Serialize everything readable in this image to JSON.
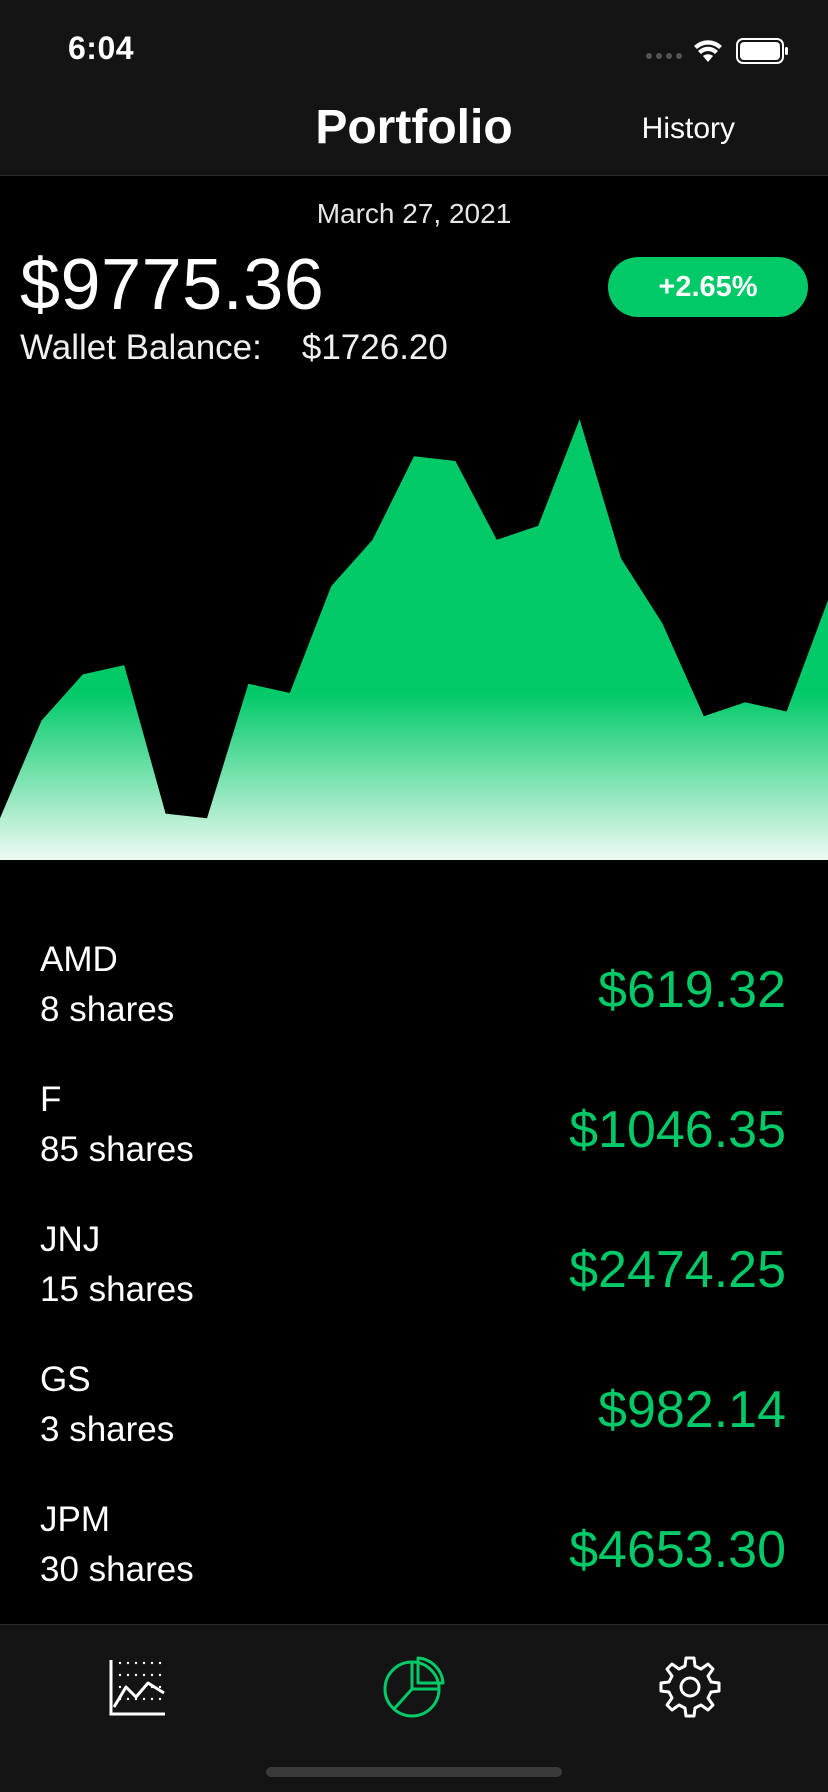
{
  "status_bar": {
    "time": "6:04",
    "icons": [
      "signal-icon",
      "wifi-icon",
      "battery-icon"
    ]
  },
  "nav": {
    "title": "Portfolio",
    "history_label": "History"
  },
  "summary": {
    "date": "March 27, 2021",
    "total_value": "$9775.36",
    "change": "+2.65%",
    "wallet_label": "Wallet Balance:",
    "wallet_value": "$1726.20"
  },
  "chart_data": {
    "type": "area",
    "values": [
      0.09,
      0.3,
      0.4,
      0.42,
      0.1,
      0.09,
      0.38,
      0.36,
      0.59,
      0.69,
      0.87,
      0.86,
      0.69,
      0.72,
      0.95,
      0.65,
      0.51,
      0.31,
      0.34,
      0.32,
      0.56
    ],
    "color": "#00c968"
  },
  "holdings": [
    {
      "symbol": "AMD",
      "shares": "8 shares",
      "value": "$619.32"
    },
    {
      "symbol": "F",
      "shares": "85 shares",
      "value": "$1046.35"
    },
    {
      "symbol": "JNJ",
      "shares": "15 shares",
      "value": "$2474.25"
    },
    {
      "symbol": "GS",
      "shares": "3 shares",
      "value": "$982.14"
    },
    {
      "symbol": "JPM",
      "shares": "30 shares",
      "value": "$4653.30"
    }
  ],
  "tabs": [
    {
      "icon": "line-chart-icon",
      "active": false
    },
    {
      "icon": "pie-chart-icon",
      "active": true
    },
    {
      "icon": "gear-icon",
      "active": false
    }
  ],
  "colors": {
    "accent": "#00c968",
    "bar_bg": "#141414",
    "background": "#000000"
  }
}
